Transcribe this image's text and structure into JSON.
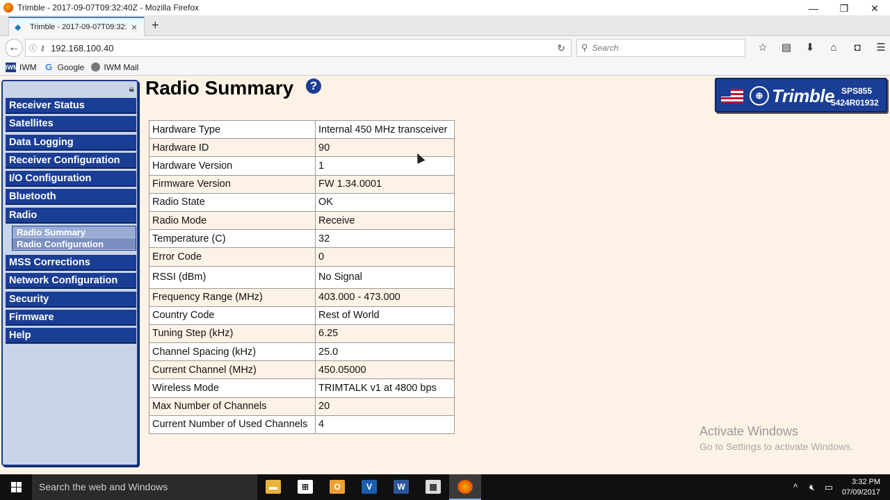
{
  "window": {
    "title": "Trimble - 2017-09-07T09:32:40Z - Mozilla Firefox",
    "controls": [
      "—",
      "❐",
      "✕"
    ]
  },
  "tabs": [
    {
      "title": "Trimble - 2017-09-07T09:32:40Z"
    }
  ],
  "navbar": {
    "url": "192.168.100.40",
    "search_placeholder": "Search"
  },
  "bookmarks": [
    {
      "label": "IWM",
      "icon": "iwm-icon"
    },
    {
      "label": "Google",
      "icon": "google-icon"
    },
    {
      "label": "IWM Mail",
      "icon": "globe-icon"
    }
  ],
  "sidebar": {
    "items_top": [
      "Receiver Status",
      "Satellites",
      "Data Logging",
      "Receiver Configuration",
      "I/O Configuration",
      "Bluetooth",
      "Radio"
    ],
    "sub_items": [
      "Radio Summary",
      "Radio Configuration"
    ],
    "items_bottom": [
      "MSS Corrections",
      "Network Configuration",
      "Security",
      "Firmware",
      "Help"
    ]
  },
  "page": {
    "title": "Radio Summary",
    "help": "?"
  },
  "brand": {
    "name": "Trimble",
    "model": "SPS855",
    "serial": "5424R01932"
  },
  "table": [
    [
      "Hardware Type",
      "Internal 450 MHz transceiver"
    ],
    [
      "Hardware ID",
      "90"
    ],
    [
      "Hardware Version",
      "1"
    ],
    [
      "Firmware Version",
      "FW 1.34.0001"
    ],
    [
      "Radio State",
      "OK"
    ],
    [
      "Radio Mode",
      "Receive"
    ],
    [
      "Temperature (C)",
      "32"
    ],
    [
      "Error Code",
      "0"
    ],
    [
      "RSSI (dBm)",
      " No Signal"
    ],
    [
      "Frequency Range (MHz)",
      "403.000 - 473.000"
    ],
    [
      "Country Code",
      "Rest of World"
    ],
    [
      "Tuning Step (kHz)",
      "6.25"
    ],
    [
      "Channel Spacing (kHz)",
      "25.0"
    ],
    [
      "Current Channel (MHz)",
      "450.05000"
    ],
    [
      "Wireless Mode",
      "TRIMTALK v1 at 4800 bps"
    ],
    [
      "Max Number of Channels",
      "20"
    ],
    [
      "Current Number of Used Channels",
      "4"
    ]
  ],
  "watermark": {
    "line1": "Activate Windows",
    "line2": "Go to Settings to activate Windows."
  },
  "taskbar": {
    "search": "Search the web and Windows",
    "time": "3:32 PM",
    "date": "07/09/2017"
  }
}
